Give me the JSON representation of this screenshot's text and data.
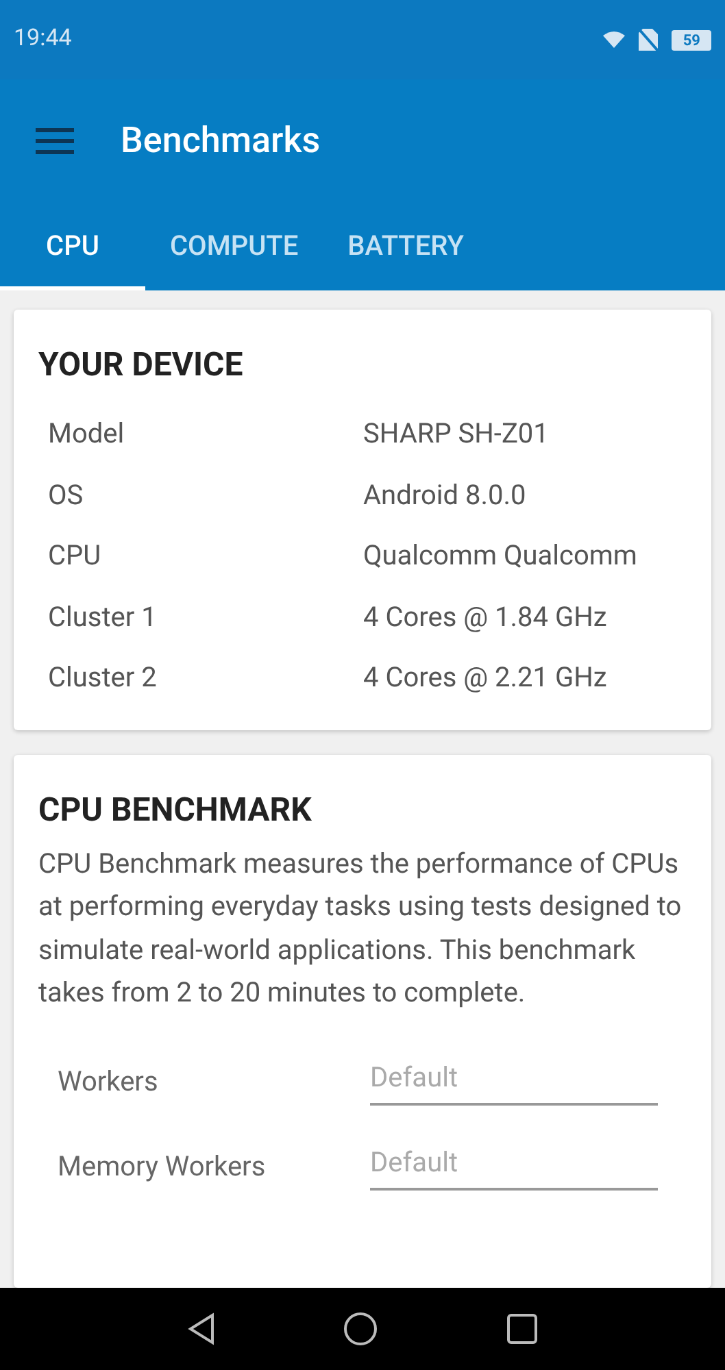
{
  "status_bar": {
    "time": "19:44",
    "battery": "59"
  },
  "toolbar": {
    "title": "Benchmarks"
  },
  "tabs": [
    {
      "label": "CPU",
      "selected": true
    },
    {
      "label": "COMPUTE",
      "selected": false
    },
    {
      "label": "BATTERY",
      "selected": false
    }
  ],
  "device_card": {
    "title": "YOUR DEVICE",
    "rows": [
      {
        "label": "Model",
        "value": "SHARP SH-Z01"
      },
      {
        "label": "OS",
        "value": "Android 8.0.0"
      },
      {
        "label": "CPU",
        "value": "Qualcomm Qualcomm"
      },
      {
        "label": "Cluster 1",
        "value": "4 Cores @ 1.84 GHz"
      },
      {
        "label": "Cluster 2",
        "value": "4 Cores @ 2.21 GHz"
      }
    ]
  },
  "benchmark_card": {
    "title": "CPU BENCHMARK",
    "description": "CPU Benchmark measures the performance of CPUs at performing everyday tasks using tests designed to simulate real-world applications. This benchmark takes from 2 to 20 minutes to complete.",
    "fields": [
      {
        "label": "Workers",
        "placeholder": "Default"
      },
      {
        "label": "Memory Workers",
        "placeholder": "Default"
      }
    ]
  }
}
